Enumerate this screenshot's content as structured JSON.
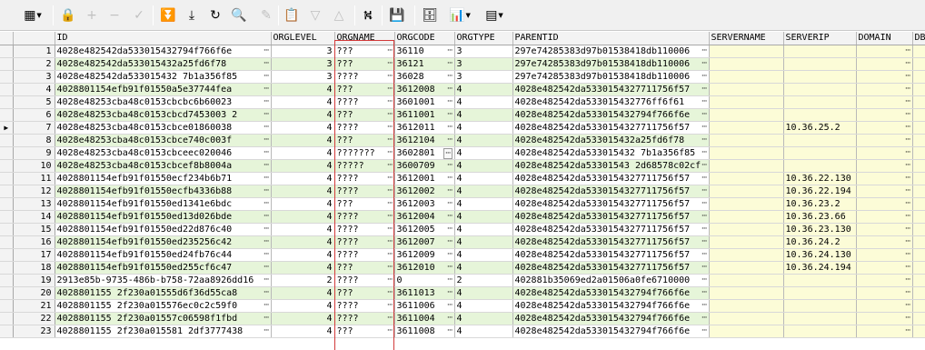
{
  "toolbar": {
    "buttons": [
      {
        "name": "grid-options-icon",
        "glyph": "▦",
        "dropdown": true,
        "enabled": true
      },
      {
        "name": "lock-icon",
        "glyph": "🔒",
        "enabled": true
      },
      {
        "name": "add-record-icon",
        "glyph": "+",
        "enabled": false
      },
      {
        "name": "delete-record-icon",
        "glyph": "−",
        "enabled": false
      },
      {
        "name": "post-changes-icon",
        "glyph": "✓",
        "enabled": false
      },
      {
        "name": "fetch-next-page-icon",
        "glyph": "⏬",
        "enabled": true
      },
      {
        "name": "fetch-last-page-icon",
        "glyph": "⤓",
        "enabled": true
      },
      {
        "name": "refresh-icon",
        "glyph": "↻",
        "enabled": true
      },
      {
        "name": "find-icon",
        "glyph": "🔍",
        "enabled": true
      },
      {
        "name": "clear-icon",
        "glyph": "✎",
        "enabled": false
      },
      {
        "name": "query-by-example-icon",
        "glyph": "📋",
        "enabled": true
      },
      {
        "name": "previous-record-icon",
        "glyph": "▽",
        "enabled": false
      },
      {
        "name": "next-record-icon",
        "glyph": "△",
        "enabled": false
      },
      {
        "name": "toggle-view-icon",
        "glyph": "⛕",
        "enabled": true
      },
      {
        "name": "save-icon",
        "glyph": "💾",
        "enabled": true
      },
      {
        "name": "export-icon",
        "glyph": "🗄",
        "enabled": true
      },
      {
        "name": "chart-icon",
        "glyph": "📊",
        "dropdown": true,
        "enabled": true
      },
      {
        "name": "grid-layout-icon",
        "glyph": "▤",
        "dropdown": true,
        "enabled": true
      }
    ]
  },
  "columns": [
    "ID",
    "ORGLEVEL",
    "ORGNAME",
    "ORGCODE",
    "ORGTYPE",
    "PARENTID",
    "SERVERNAME",
    "SERVERIP",
    "DOMAIN",
    "DBI"
  ],
  "current_row": 7,
  "rows": [
    {
      "n": "1",
      "id": "4028e482542da533015432794f766f6e",
      "level": "3",
      "name": "???",
      "code": "36110",
      "type": "3",
      "parent": "297e74285383d97b01538418db110006",
      "server": "",
      "ip": "",
      "domain": ""
    },
    {
      "n": "2",
      "id": "4028e482542da533015432a25fd6f78",
      "level": "3",
      "name": "???",
      "code": "36121",
      "type": "3",
      "parent": "297e74285383d97b01538418db110006",
      "server": "",
      "ip": "",
      "domain": ""
    },
    {
      "n": "3",
      "id": "4028e482542da533015432 7b1a356f85",
      "level": "3",
      "name": "????",
      "code": "36028",
      "type": "3",
      "parent": "297e74285383d97b01538418db110006",
      "server": "",
      "ip": "",
      "domain": ""
    },
    {
      "n": "4",
      "id": "4028801154efb91f01550a5e37744fea",
      "level": "4",
      "name": "???",
      "code": "3612008",
      "type": "4",
      "parent": "4028e482542da5330154327711756f57",
      "server": "",
      "ip": "",
      "domain": ""
    },
    {
      "n": "5",
      "id": "4028e48253cba48c0153cbcbc6b60023",
      "level": "4",
      "name": "????",
      "code": "3601001",
      "type": "4",
      "parent": "4028e482542da533015432776ff6f61",
      "server": "",
      "ip": "",
      "domain": ""
    },
    {
      "n": "6",
      "id": "4028e48253cba48c0153cbcd7453003 2",
      "level": "4",
      "name": "???",
      "code": "3611001",
      "type": "4",
      "parent": "4028e482542da533015432794f766f6e",
      "server": "",
      "ip": "",
      "domain": ""
    },
    {
      "n": "7",
      "id": "4028e48253cba48c0153cbce01860038",
      "level": "4",
      "name": "????",
      "code": "3612011",
      "type": "4",
      "parent": "4028e482542da5330154327711756f57",
      "server": "",
      "ip": "10.36.25.2",
      "domain": ""
    },
    {
      "n": "8",
      "id": "4028e48253cba48c0153cbce740c003f",
      "level": "4",
      "name": "???",
      "code": "3612104",
      "type": "4",
      "parent": "4028e482542da533015432a25fd6f78",
      "server": "",
      "ip": "",
      "domain": ""
    },
    {
      "n": "9",
      "id": "4028e48253cba48c0153cbceec020046",
      "level": "4",
      "name": "???????",
      "code": "3602801",
      "type": "4",
      "parent": "4028e482542da533015432 7b1a356f85",
      "server": "",
      "ip": "",
      "domain": ""
    },
    {
      "n": "10",
      "id": "4028e48253cba48c0153cbcef8b8004a",
      "level": "4",
      "name": "?????",
      "code": "3600709",
      "type": "4",
      "parent": "4028e482542da53301543 2d68578c02cf",
      "server": "",
      "ip": "",
      "domain": ""
    },
    {
      "n": "11",
      "id": "4028801154efb91f01550ecf234b6b71",
      "level": "4",
      "name": "????",
      "code": "3612001",
      "type": "4",
      "parent": "4028e482542da5330154327711756f57",
      "server": "",
      "ip": "10.36.22.130",
      "domain": ""
    },
    {
      "n": "12",
      "id": "4028801154efb91f01550ecfb4336b88",
      "level": "4",
      "name": "????",
      "code": "3612002",
      "type": "4",
      "parent": "4028e482542da5330154327711756f57",
      "server": "",
      "ip": "10.36.22.194",
      "domain": ""
    },
    {
      "n": "13",
      "id": "4028801154efb91f01550ed1341e6bdc",
      "level": "4",
      "name": "???",
      "code": "3612003",
      "type": "4",
      "parent": "4028e482542da5330154327711756f57",
      "server": "",
      "ip": "10.36.23.2",
      "domain": ""
    },
    {
      "n": "14",
      "id": "4028801154efb91f01550ed13d026bde",
      "level": "4",
      "name": "????",
      "code": "3612004",
      "type": "4",
      "parent": "4028e482542da5330154327711756f57",
      "server": "",
      "ip": "10.36.23.66",
      "domain": ""
    },
    {
      "n": "15",
      "id": "4028801154efb91f01550ed22d876c40",
      "level": "4",
      "name": "????",
      "code": "3612005",
      "type": "4",
      "parent": "4028e482542da5330154327711756f57",
      "server": "",
      "ip": "10.36.23.130",
      "domain": ""
    },
    {
      "n": "16",
      "id": "4028801154efb91f01550ed235256c42",
      "level": "4",
      "name": "????",
      "code": "3612007",
      "type": "4",
      "parent": "4028e482542da5330154327711756f57",
      "server": "",
      "ip": "10.36.24.2",
      "domain": ""
    },
    {
      "n": "17",
      "id": "4028801154efb91f01550ed24fb76c44",
      "level": "4",
      "name": "????",
      "code": "3612009",
      "type": "4",
      "parent": "4028e482542da5330154327711756f57",
      "server": "",
      "ip": "10.36.24.130",
      "domain": ""
    },
    {
      "n": "18",
      "id": "4028801154efb91f01550ed255cf6c47",
      "level": "4",
      "name": "???",
      "code": "3612010",
      "type": "4",
      "parent": "4028e482542da5330154327711756f57",
      "server": "",
      "ip": "10.36.24.194",
      "domain": ""
    },
    {
      "n": "19",
      "id": "2913e85b-9735-486b-b758-72aa8926dd16",
      "level": "2",
      "name": "????",
      "code": "0",
      "type": "2",
      "parent": "402881b35069ed2a01506a0fe6710000",
      "server": "",
      "ip": "",
      "domain": ""
    },
    {
      "n": "20",
      "id": "4028801155 2f230a01555d6f36d55ca8",
      "level": "4",
      "name": "???",
      "code": "3611013",
      "type": "4",
      "parent": "4028e482542da533015432794f766f6e",
      "server": "",
      "ip": "",
      "domain": ""
    },
    {
      "n": "21",
      "id": "4028801155 2f230a015576ec0c2c59f0",
      "level": "4",
      "name": "????",
      "code": "3611006",
      "type": "4",
      "parent": "4028e482542da533015432794f766f6e",
      "server": "",
      "ip": "",
      "domain": ""
    },
    {
      "n": "22",
      "id": "4028801155 2f230a01557c06598f1fbd",
      "level": "4",
      "name": "????",
      "code": "3611004",
      "type": "4",
      "parent": "4028e482542da533015432794f766f6e",
      "server": "",
      "ip": "",
      "domain": ""
    },
    {
      "n": "23",
      "id": "4028801155 2f230a015581 2df3777438",
      "level": "4",
      "name": "???",
      "code": "3611008",
      "type": "4",
      "parent": "4028e482542da533015432794f766f6e",
      "server": "",
      "ip": "",
      "domain": ""
    }
  ]
}
